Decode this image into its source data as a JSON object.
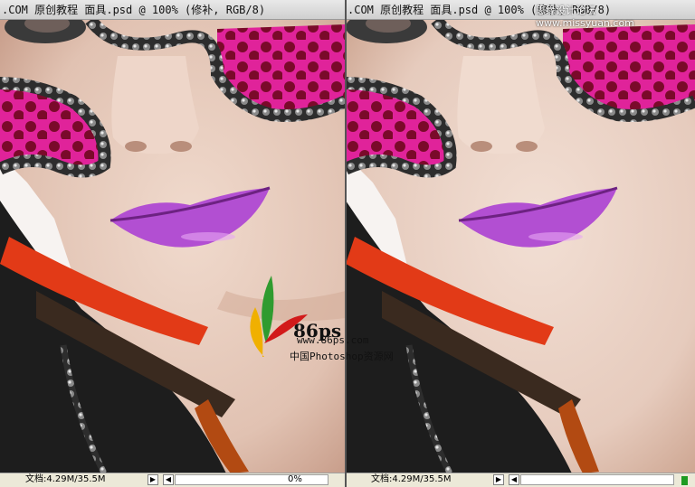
{
  "left_window": {
    "title": ".COM 原创教程 面具.psd @ 100% (修补, RGB/8)",
    "status_text": "文档:4.29M/35.5M",
    "zoom": "0%"
  },
  "right_window": {
    "title": ".COM 原创教程 面具.psd @ 100% (修补, RGB/8)",
    "status_text": "文档:4.29M/35.5M"
  },
  "watermark": {
    "logo_text": "86ps",
    "url": "www.86ps.com",
    "caption": "中国Photoshop资源网",
    "corner_text": "思缘设计论坛 www.missyuan.com"
  },
  "colors": {
    "skin": "#e6cdbf",
    "lips": "#b24fd2",
    "mask_pink": "#e0239a",
    "mask_dots": "#7a0a2a",
    "sequin": "#3b3b3b",
    "hair": "#1d1d1d",
    "feather_red": "#e23a17"
  }
}
